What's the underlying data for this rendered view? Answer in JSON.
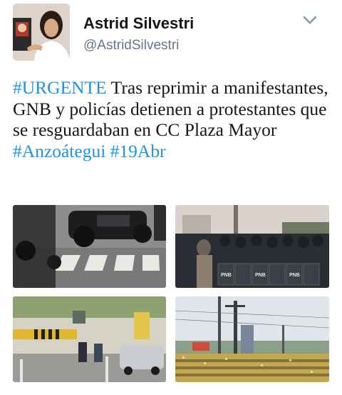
{
  "author": {
    "name": "Astrid Silvestri",
    "handle": "@AstridSilvestri"
  },
  "tweet": {
    "hashtag_urgent": "#URGENTE",
    "body": " Tras reprimir a manifestantes, GNB y policías detienen a protestantes que se resguardaban en CC Plaza Mayor ",
    "hashtag_place": "#Anzoátegui",
    "hashtag_date": "#19Abr"
  },
  "media": {
    "photo2_shield_text": "PNB"
  },
  "colors": {
    "hashtag": "#1b95e0",
    "name": "#14171a",
    "handle": "#657786",
    "chevron": "#8899a6"
  },
  "icons": {
    "menu": "chevron-down-icon"
  }
}
